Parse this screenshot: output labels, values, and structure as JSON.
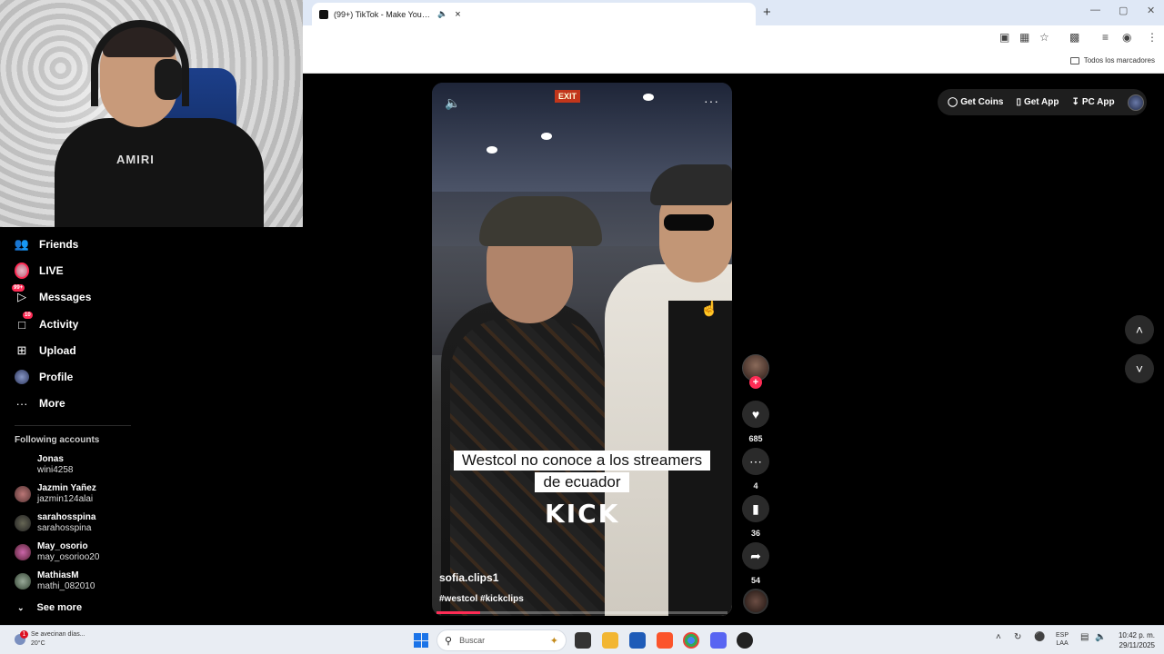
{
  "browser": {
    "tab_title": "(99+) TikTok - Make Your D...",
    "tab_mute_icon": "speaker-icon",
    "new_tab": "+",
    "bookmarks_all": "Todos los marcadores"
  },
  "sidebar": {
    "items": [
      {
        "label": "Friends"
      },
      {
        "label": "LIVE"
      },
      {
        "label": "Messages",
        "badge": "99+"
      },
      {
        "label": "Activity",
        "badge": "10"
      },
      {
        "label": "Upload"
      },
      {
        "label": "Profile"
      },
      {
        "label": "More"
      }
    ],
    "following_title": "Following accounts",
    "accounts": [
      {
        "name": "Jonas",
        "handle": "wini4258"
      },
      {
        "name": "Jazmin Yañez",
        "handle": "jazmin124alai"
      },
      {
        "name": "sarahosspina",
        "handle": "sarahosspina"
      },
      {
        "name": "May_osorio",
        "handle": "may_osorioo20"
      },
      {
        "name": "MathiasM",
        "handle": "mathi_082010"
      }
    ],
    "see_more": "See more"
  },
  "video": {
    "caption_line1": "Westcol no conoce a los streamers",
    "caption_line2": "de ecuador",
    "watermark": "KICK",
    "author": "sofia.clips1",
    "tags": "#westcol #kickclips",
    "progress": 0.15,
    "exit_sign": "EXIT"
  },
  "actions": {
    "likes": "685",
    "comments": "4",
    "saves": "36",
    "shares": "54"
  },
  "top_buttons": {
    "coins": "Get Coins",
    "app": "Get App",
    "pc": "PC App"
  },
  "webcam": {
    "shirt_logo": "AMIRI"
  },
  "taskbar": {
    "weather_line1": "Se avecinan días...",
    "weather_line2": "20°C",
    "weather_badge": "1",
    "search_placeholder": "Buscar",
    "lang_line1": "ESP",
    "lang_line2": "LAA",
    "time": "10:42 p. m.",
    "date": "29/11/2025"
  },
  "colors": {
    "accent": "#fe2c55",
    "background": "#000000",
    "taskbar": "#e9edf3"
  }
}
